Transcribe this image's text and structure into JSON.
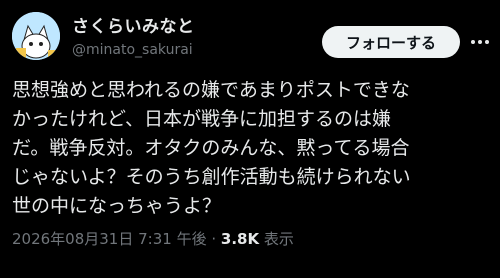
{
  "user": {
    "display_name": "さくらいみなと",
    "handle": "@minato_sakurai"
  },
  "follow_button_label": "フォローする",
  "more_icon": "more-dots-icon",
  "post": {
    "lines": [
      "思想強めと思われるの嫌であまりポストできな",
      "かったけれど、日本が戦争に加担するのは嫌",
      "だ。戦争反対。オタクのみんな、黙ってる場合",
      "じゃないよ？そのうち創作活動も続けられない",
      "世の中になっちゃうよ？"
    ],
    "timestamp": "2026年08月31日 7:31 午後",
    "separator": " · ",
    "views_count": "3.8K",
    "views_label": " 表示"
  },
  "colors": {
    "background": "#000000",
    "text": "#e7e9ea",
    "secondary": "#71767b",
    "button_bg": "#eff3f4"
  }
}
